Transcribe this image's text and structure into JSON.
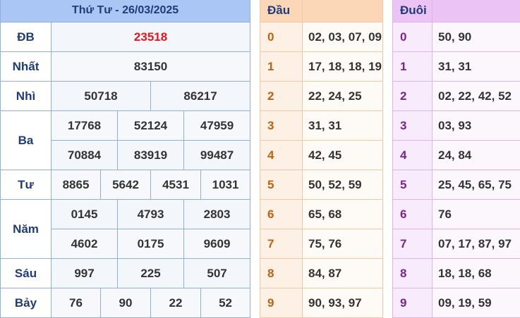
{
  "results": {
    "date_title": "Thứ Tư - 26/03/2025",
    "prizes": [
      {
        "label": "ĐB",
        "numbers": [
          "23518"
        ]
      },
      {
        "label": "Nhất",
        "numbers": [
          "83150"
        ]
      },
      {
        "label": "Nhì",
        "numbers": [
          "50718",
          "86217"
        ]
      },
      {
        "label": "Ba",
        "numbers": [
          "17768",
          "52124",
          "47959",
          "70884",
          "83919",
          "99487"
        ]
      },
      {
        "label": "Tư",
        "numbers": [
          "8865",
          "5642",
          "4531",
          "1031"
        ]
      },
      {
        "label": "Năm",
        "numbers": [
          "0145",
          "4793",
          "2803",
          "4602",
          "0175",
          "9609"
        ]
      },
      {
        "label": "Sáu",
        "numbers": [
          "997",
          "225",
          "507"
        ]
      },
      {
        "label": "Bảy",
        "numbers": [
          "76",
          "90",
          "22",
          "52"
        ]
      }
    ]
  },
  "dau": {
    "header": "Đầu",
    "rows": [
      {
        "k": "0",
        "v": "02, 03, 07, 09"
      },
      {
        "k": "1",
        "v": "17, 18, 18, 19"
      },
      {
        "k": "2",
        "v": "22, 24, 25"
      },
      {
        "k": "3",
        "v": "31, 31"
      },
      {
        "k": "4",
        "v": "42, 45"
      },
      {
        "k": "5",
        "v": "50, 52, 59"
      },
      {
        "k": "6",
        "v": "65, 68"
      },
      {
        "k": "7",
        "v": "75, 76"
      },
      {
        "k": "8",
        "v": "84, 87"
      },
      {
        "k": "9",
        "v": "90, 93, 97"
      }
    ]
  },
  "duoi": {
    "header": "Đuôi",
    "rows": [
      {
        "k": "0",
        "v": "50, 90"
      },
      {
        "k": "1",
        "v": "31, 31"
      },
      {
        "k": "2",
        "v": "02, 22, 42, 52"
      },
      {
        "k": "3",
        "v": "03, 93"
      },
      {
        "k": "4",
        "v": "24, 84"
      },
      {
        "k": "5",
        "v": "25, 45, 65, 75"
      },
      {
        "k": "6",
        "v": "76"
      },
      {
        "k": "7",
        "v": "07, 17, 87, 97"
      },
      {
        "k": "8",
        "v": "18, 18, 68"
      },
      {
        "k": "9",
        "v": "09, 19, 59"
      }
    ]
  },
  "colors": {
    "special_number": "#e8161b",
    "results_header": "#a9c6f5",
    "dau_header": "#fbd7b8",
    "duoi_header": "#ebc4f5"
  }
}
